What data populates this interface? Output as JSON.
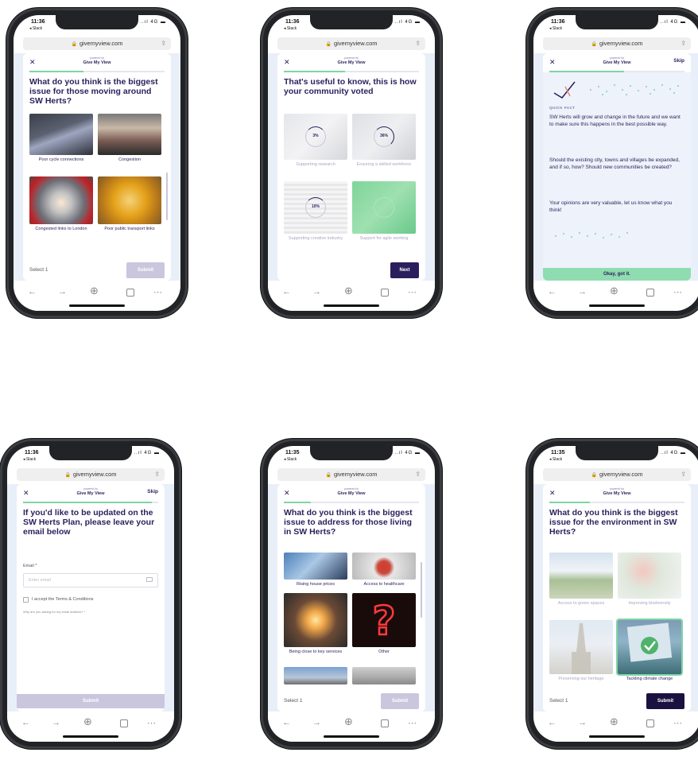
{
  "common": {
    "url": "givemyview.com",
    "back_app": "◂ Slack",
    "signal": "..ıl 4G ▬",
    "brand": "Give My View",
    "brand_small": "powered by",
    "close": "✕",
    "skip": "Skip",
    "select_count": "Select 1",
    "submit": "Submit",
    "next": "Next"
  },
  "screens": [
    {
      "id": "s1",
      "time": "11:36",
      "question": "What do you think is the biggest issue for those moving around SW Herts?",
      "options": [
        {
          "label": "Poor cycle connections"
        },
        {
          "label": "Congestion"
        },
        {
          "label": "Congested links to London"
        },
        {
          "label": "Poor public transport links"
        }
      ]
    },
    {
      "id": "s2",
      "time": "11:36",
      "question": "That's useful to know, this is how your community voted",
      "options": [
        {
          "label": "Supporting research",
          "pct": "3%"
        },
        {
          "label": "Ensuring a skilled workforce",
          "pct": "36%"
        },
        {
          "label": "Supporting creative industry",
          "pct": "10%"
        },
        {
          "label": "Support for agile working",
          "pct": ""
        }
      ]
    },
    {
      "id": "s3",
      "time": "11:36",
      "fact_title": "QUICK FACT",
      "paragraphs": [
        "SW Herts will grow and change in the future and we want to make sure this happens in the best possible way.",
        "Should the existing city, towns and villages be expanded, and if so, how? Should new communities be created?",
        "Your opinions are very valuable, let us know what you think!"
      ],
      "ok": "Okay, got it."
    },
    {
      "id": "s4",
      "time": "11:36",
      "question": "If you'd like to be updated on the SW Herts Plan, please leave your email below",
      "email_label": "Email *",
      "email_placeholder": "Enter email",
      "terms": "I accept the Terms & Conditions",
      "why": "Why are you asking for my email address? *"
    },
    {
      "id": "s5",
      "time": "11:35",
      "question": "What do you think is the biggest issue to address for those living in SW Herts?",
      "options": [
        {
          "label": "Rising house prices"
        },
        {
          "label": "Access to healthcare"
        },
        {
          "label": "Being close to key services"
        },
        {
          "label": "Other"
        }
      ]
    },
    {
      "id": "s6",
      "time": "11:35",
      "question": "What do you think is the biggest issue for the environment in SW Herts?",
      "options": [
        {
          "label": "Access to green spaces"
        },
        {
          "label": "Improving biodiversity"
        },
        {
          "label": "Preserving our heritage"
        },
        {
          "label": "Tackling climate change"
        }
      ]
    }
  ],
  "colors": {
    "navy": "#2a1f5c",
    "green": "#7fd4a6",
    "disabled": "#c9c6de"
  }
}
